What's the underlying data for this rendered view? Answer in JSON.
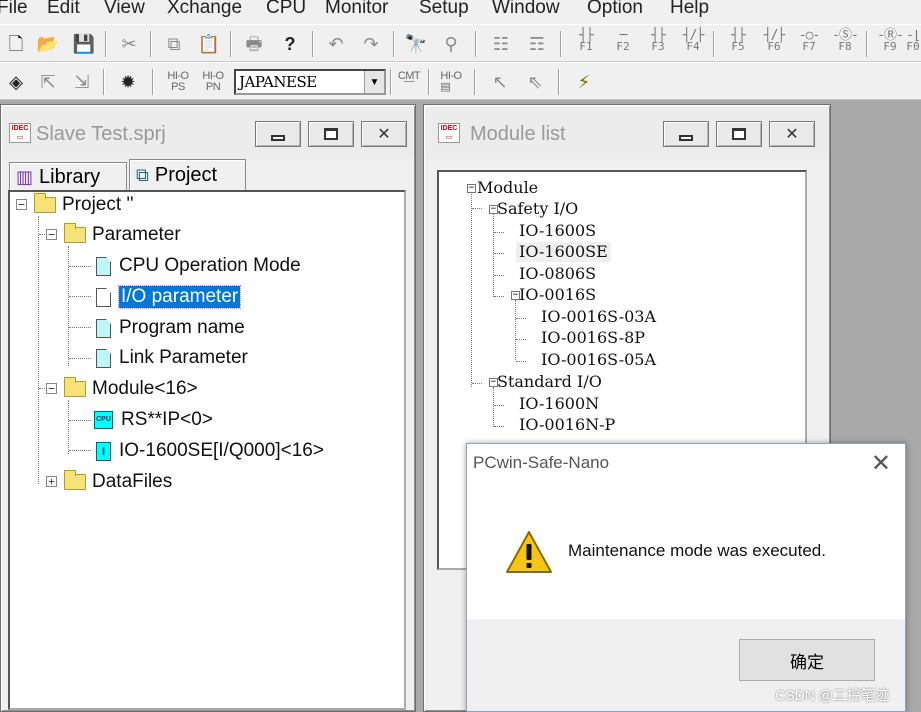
{
  "menu": [
    "File",
    "Edit",
    "View",
    "Xchange",
    "CPU",
    "Monitor",
    "Setup",
    "Window",
    "Option",
    "Help"
  ],
  "toolbar": {
    "language_value": "JAPANESE",
    "ps_label_top": "HI-O",
    "ps_label": "PS",
    "pn_label_top": "HI-O",
    "pn_label": "PN",
    "cmt_label": "CMT",
    "function_keys": [
      "F1",
      "F2",
      "F3",
      "F4",
      "F5",
      "F6",
      "F7",
      "F8",
      "F9",
      "F0"
    ]
  },
  "slave_window": {
    "title": "Slave Test.sprj",
    "tabs": [
      {
        "label": "Library"
      },
      {
        "label": "Project"
      }
    ],
    "tree": {
      "root": "Project ''",
      "parameter": "Parameter",
      "cpu_operation_mode": "CPU Operation Mode",
      "io_parameter": "I/O parameter",
      "program_name": "Program name",
      "link_parameter": "Link Parameter",
      "module": "Module<16>",
      "rs_ip": "RS**IP<0>",
      "io_module": "IO-1600SE[I/Q000]<16>",
      "datafiles": "DataFiles",
      "cpu_icon_text": "CPU",
      "io_icon_text": "I"
    }
  },
  "module_window": {
    "title": "Module list",
    "tree": {
      "root": "Module",
      "safety_io": "Safety I/O",
      "safety_items": [
        "IO-1600S",
        "IO-1600SE",
        "IO-0806S"
      ],
      "io_0016s": "IO-0016S",
      "io_0016s_items": [
        "IO-0016S-03A",
        "IO-0016S-8P",
        "IO-0016S-05A"
      ],
      "standard_io": "Standard I/O",
      "standard_items": [
        "IO-1600N",
        "IO-0016N-P"
      ]
    }
  },
  "dialog": {
    "title": "PCwin-Safe-Nano",
    "message": "Maintenance mode was executed.",
    "ok_label": "确定"
  },
  "watermark": "CSDN @工控笔迹",
  "colors": {
    "selection": "#0078d7",
    "doc_icon": "#bdf6f6",
    "folder": "#f7e27a",
    "mdi_background": "#a9a9a9"
  }
}
